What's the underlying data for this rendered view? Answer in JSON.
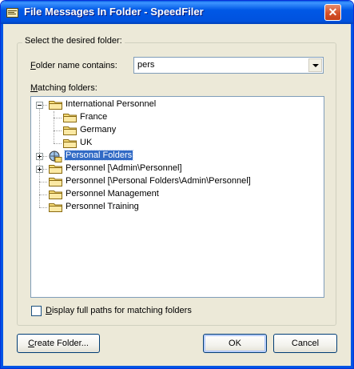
{
  "window": {
    "title": "File Messages In Folder - SpeedFiler"
  },
  "group": {
    "label": "Select the desired folder:"
  },
  "folder_name": {
    "label_prefix": "",
    "label_hotkey": "F",
    "label_rest": "older name contains:",
    "value": "pers"
  },
  "matching": {
    "label_hotkey": "M",
    "label_rest": "atching folders:"
  },
  "tree": {
    "nodes": [
      {
        "label": "International Personnel",
        "expander": "minus",
        "icon": "folder"
      },
      {
        "label": "France",
        "expander": "none",
        "icon": "folder"
      },
      {
        "label": "Germany",
        "expander": "none",
        "icon": "folder"
      },
      {
        "label": "UK",
        "expander": "none",
        "icon": "folder"
      },
      {
        "label": "Personal Folders",
        "expander": "plus",
        "icon": "personal-folders",
        "selected": true
      },
      {
        "label": "Personnel [\\Admin\\Personnel]",
        "expander": "plus",
        "icon": "folder"
      },
      {
        "label": "Personnel [\\Personal Folders\\Admin\\Personnel]",
        "expander": "none",
        "icon": "folder"
      },
      {
        "label": "Personnel Management",
        "expander": "none",
        "icon": "folder"
      },
      {
        "label": "Personnel Training",
        "expander": "none",
        "icon": "folder"
      }
    ]
  },
  "checkbox": {
    "label_hotkey": "D",
    "label_rest": "isplay full paths for matching folders",
    "checked": false
  },
  "buttons": {
    "create_hotkey": "C",
    "create_rest": "reate Folder...",
    "ok": "OK",
    "cancel": "Cancel"
  },
  "colors": {
    "selection": "#316ac5",
    "titlebar": "#0058e6",
    "dialog_bg": "#ece9d8"
  }
}
